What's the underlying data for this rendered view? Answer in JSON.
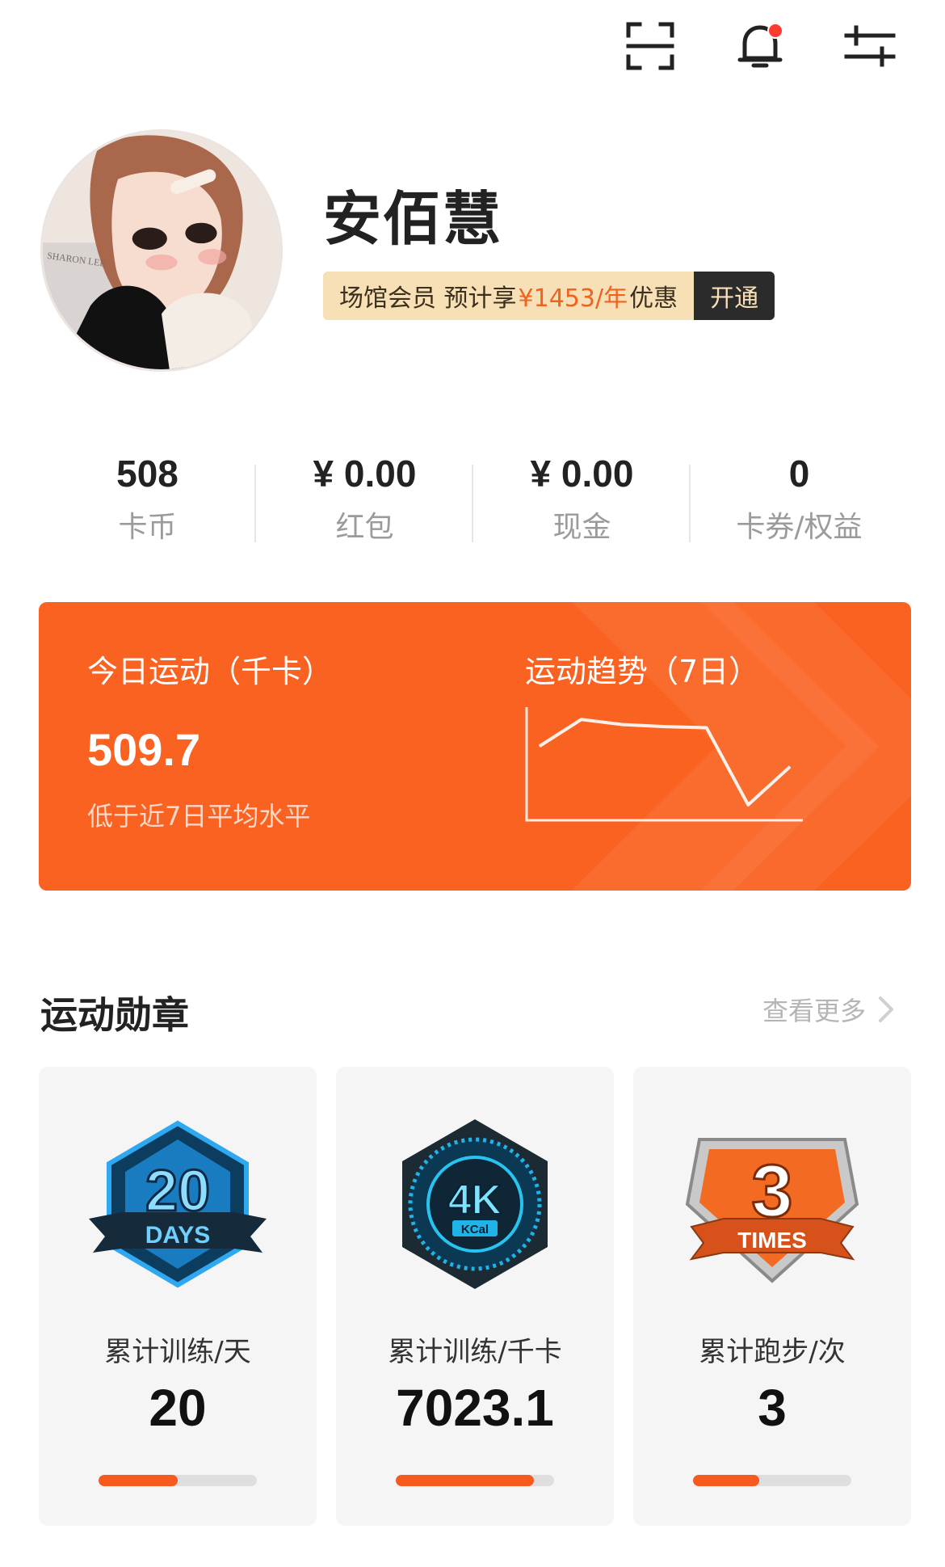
{
  "icons": {
    "scan": "scan-icon",
    "bell": "bell-icon",
    "settings": "settings-sliders-icon"
  },
  "profile": {
    "name": "安佰慧",
    "vip_prefix": "场馆会员 预计享",
    "vip_price": "¥1453/年",
    "vip_suffix": "优惠",
    "vip_button": "开通",
    "avatar_watermark": "SHARON LEE"
  },
  "stats": [
    {
      "value": "508",
      "label": "卡币"
    },
    {
      "value": "¥ 0.00",
      "label": "红包"
    },
    {
      "value": "¥ 0.00",
      "label": "现金"
    },
    {
      "value": "0",
      "label": "卡券/权益"
    }
  ],
  "sport_card": {
    "title": "今日运动（千卡）",
    "value": "509.7",
    "note": "低于近7日平均水平",
    "trend_title": "运动趋势（7日）"
  },
  "chart_data": {
    "type": "line",
    "title": "运动趋势（7日）",
    "x": [
      1,
      2,
      3,
      4,
      5,
      6,
      7
    ],
    "series": [
      {
        "values": [
          0.72,
          0.98,
          0.93,
          0.91,
          0.9,
          0.15,
          0.52
        ]
      }
    ],
    "ylim": [
      0,
      1.1
    ],
    "grid": false
  },
  "medals_section": {
    "title": "运动勋章",
    "more": "查看更多"
  },
  "medals": [
    {
      "badge_top": "20",
      "badge_bottom": "DAYS",
      "label": "累计训练/天",
      "value": "20",
      "progress": 0.5,
      "color": "#2ea8f0"
    },
    {
      "badge_top": "4K",
      "badge_bottom": "KCal",
      "label": "累计训练/千卡",
      "value": "7023.1",
      "progress": 0.87,
      "color": "#1fb3e8"
    },
    {
      "badge_top": "3",
      "badge_bottom": "TIMES",
      "label": "累计跑步/次",
      "value": "3",
      "progress": 0.42,
      "color": "#f36b23"
    }
  ],
  "colors": {
    "accent": "#fa6221",
    "progress": "#f65a1e",
    "vip_bg": "#f7dfb6"
  }
}
